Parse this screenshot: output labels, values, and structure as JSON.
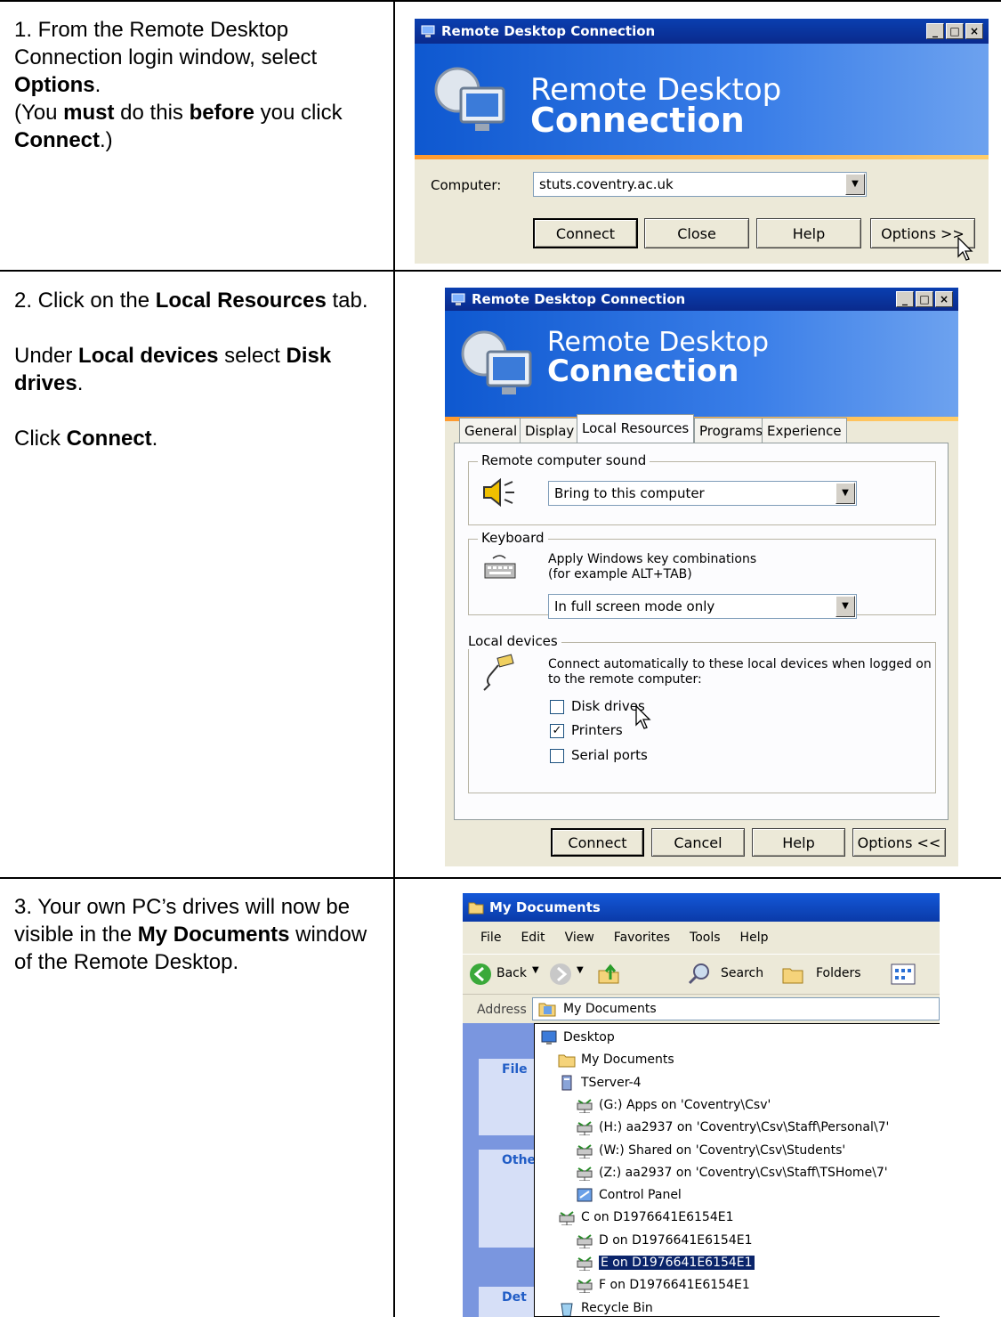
{
  "steps": [
    {
      "number": "1.",
      "parts": [
        {
          "t": "From the Remote Desktop Connection login window, select "
        },
        {
          "b": "Options"
        },
        {
          "t": "."
        }
      ],
      "parts2": [
        {
          "t": "(You "
        },
        {
          "b": "must"
        },
        {
          "t": " do this "
        },
        {
          "b": "before"
        },
        {
          "t": " you click "
        },
        {
          "b": "Connect"
        },
        {
          "t": ".)"
        }
      ]
    }
  ],
  "step1": {
    "p1_a": "1. From the Remote Desktop Connection login window, select ",
    "p1_b": "Options",
    "p1_c": ".",
    "p2_a": "(You ",
    "p2_b": "must",
    "p2_c": " do this ",
    "p2_d": "before",
    "p2_e": " you click ",
    "p2_f": "Connect",
    "p2_g": ".)"
  },
  "step2": {
    "p1_a": "2. Click on the ",
    "p1_b": "Local Resources",
    "p1_c": " tab.",
    "p2_a": "Under ",
    "p2_b": "Local devices",
    "p2_c": " select ",
    "p2_d": "Disk drives",
    "p2_e": ".",
    "p3_a": "Click ",
    "p3_b": "Connect",
    "p3_c": "."
  },
  "step3": {
    "p1_a": "3. Your own PC’s drives will now be visible in the ",
    "p1_b": "My Documents",
    "p1_c": " window of the Remote Desktop."
  },
  "rdc1": {
    "title": "Remote Desktop Connection",
    "banner_line1": "Remote Desktop",
    "banner_line2": "Connection",
    "computer_label": "Computer:",
    "computer_value": "stuts.coventry.ac.uk",
    "buttons": {
      "connect": "Connect",
      "close": "Close",
      "help": "Help",
      "options": "Options >>"
    }
  },
  "rdc2": {
    "title": "Remote Desktop Connection",
    "banner_line1": "Remote Desktop",
    "banner_line2": "Connection",
    "tabs": {
      "general": "General",
      "display": "Display",
      "local": "Local Resources",
      "programs": "Programs",
      "experience": "Experience"
    },
    "sound_group": "Remote computer sound",
    "sound_value": "Bring to this computer",
    "keyboard_group": "Keyboard",
    "keyboard_text1": "Apply Windows key combinations",
    "keyboard_text2": "(for example ALT+TAB)",
    "keyboard_value": "In full screen mode only",
    "devices_group": "Local devices",
    "devices_text1": "Connect automatically to these local devices when logged on",
    "devices_text2": "to the remote computer:",
    "disk_drives": "Disk drives",
    "printers": "Printers",
    "serial_ports": "Serial ports",
    "buttons": {
      "connect": "Connect",
      "cancel": "Cancel",
      "help": "Help",
      "options": "Options <<"
    }
  },
  "explorer": {
    "title": "My Documents",
    "menu": {
      "file": "File",
      "edit": "Edit",
      "view": "View",
      "favorites": "Favorites",
      "tools": "Tools",
      "help": "Help"
    },
    "toolbar": {
      "back": "Back",
      "search": "Search",
      "folders": "Folders"
    },
    "address_label": "Address",
    "address_value": "My Documents",
    "side": {
      "file": "File",
      "other": "Othe",
      "details": "Det"
    },
    "tree": [
      "Desktop",
      "My Documents",
      "TServer-4",
      "(G:) Apps on 'Coventry\\Csv'",
      "(H:) aa2937 on 'Coventry\\Csv\\Staff\\Personal\\7'",
      "(W:) Shared on 'Coventry\\Csv\\Students'",
      "(Z:) aa2937 on 'Coventry\\Csv\\Staff\\TSHome\\7'",
      "Control Panel",
      "C on D1976641E6154E1",
      "D on D1976641E6154E1",
      "E on D1976641E6154E1",
      "F on D1976641E6154E1",
      "Recycle Bin"
    ]
  }
}
